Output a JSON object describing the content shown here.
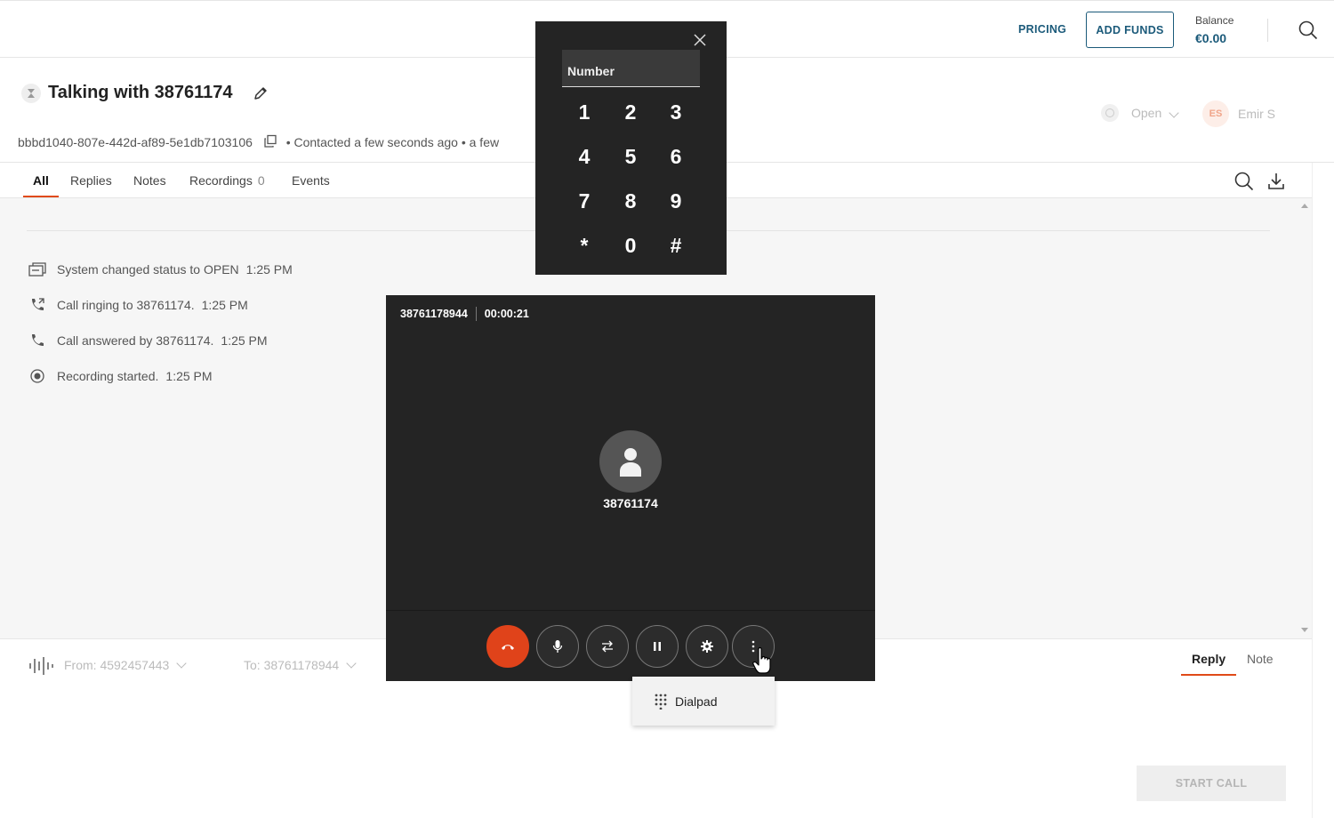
{
  "topbar": {
    "pricing_label": "PRICING",
    "add_funds_label": "ADD FUNDS",
    "balance_label": "Balance",
    "balance_value": "€0.00"
  },
  "header": {
    "title": "Talking with 38761174",
    "conversation_id": "bbbd1040-807e-442d-af89-5e1db7103106",
    "contacted": "• Contacted a few seconds ago",
    "extra": "• a few",
    "status": "Open",
    "assignee_initials": "ES",
    "assignee_name": "Emir S"
  },
  "tabs": {
    "all": "All",
    "replies": "Replies",
    "notes": "Notes",
    "recordings": "Recordings",
    "recordings_count": "0",
    "events": "Events"
  },
  "events": [
    {
      "text": "System changed status to OPEN",
      "time": "1:25 PM",
      "icon": "status-change-icon"
    },
    {
      "text": "Call ringing to 38761174.",
      "time": "1:25 PM",
      "icon": "phone-forward-icon"
    },
    {
      "text": "Call answered by 38761174.",
      "time": "1:25 PM",
      "icon": "phone-icon"
    },
    {
      "text": "Recording started.",
      "time": "1:25 PM",
      "icon": "record-icon"
    }
  ],
  "composer": {
    "from": "From: 4592457443",
    "to": "To: 38761178944",
    "reply_tab": "Reply",
    "note_tab": "Note",
    "start_call": "START CALL"
  },
  "call": {
    "number": "38761178944",
    "duration": "00:00:21",
    "caller_name": "38761174"
  },
  "dialpad": {
    "placeholder": "Number",
    "keys": [
      "1",
      "2",
      "3",
      "4",
      "5",
      "6",
      "7",
      "8",
      "9",
      "*",
      "0",
      "#"
    ]
  },
  "menu": {
    "dialpad_label": "Dialpad"
  },
  "colors": {
    "accent": "#e04a18",
    "brand": "#1b5a7a",
    "call_bg": "#242424"
  }
}
